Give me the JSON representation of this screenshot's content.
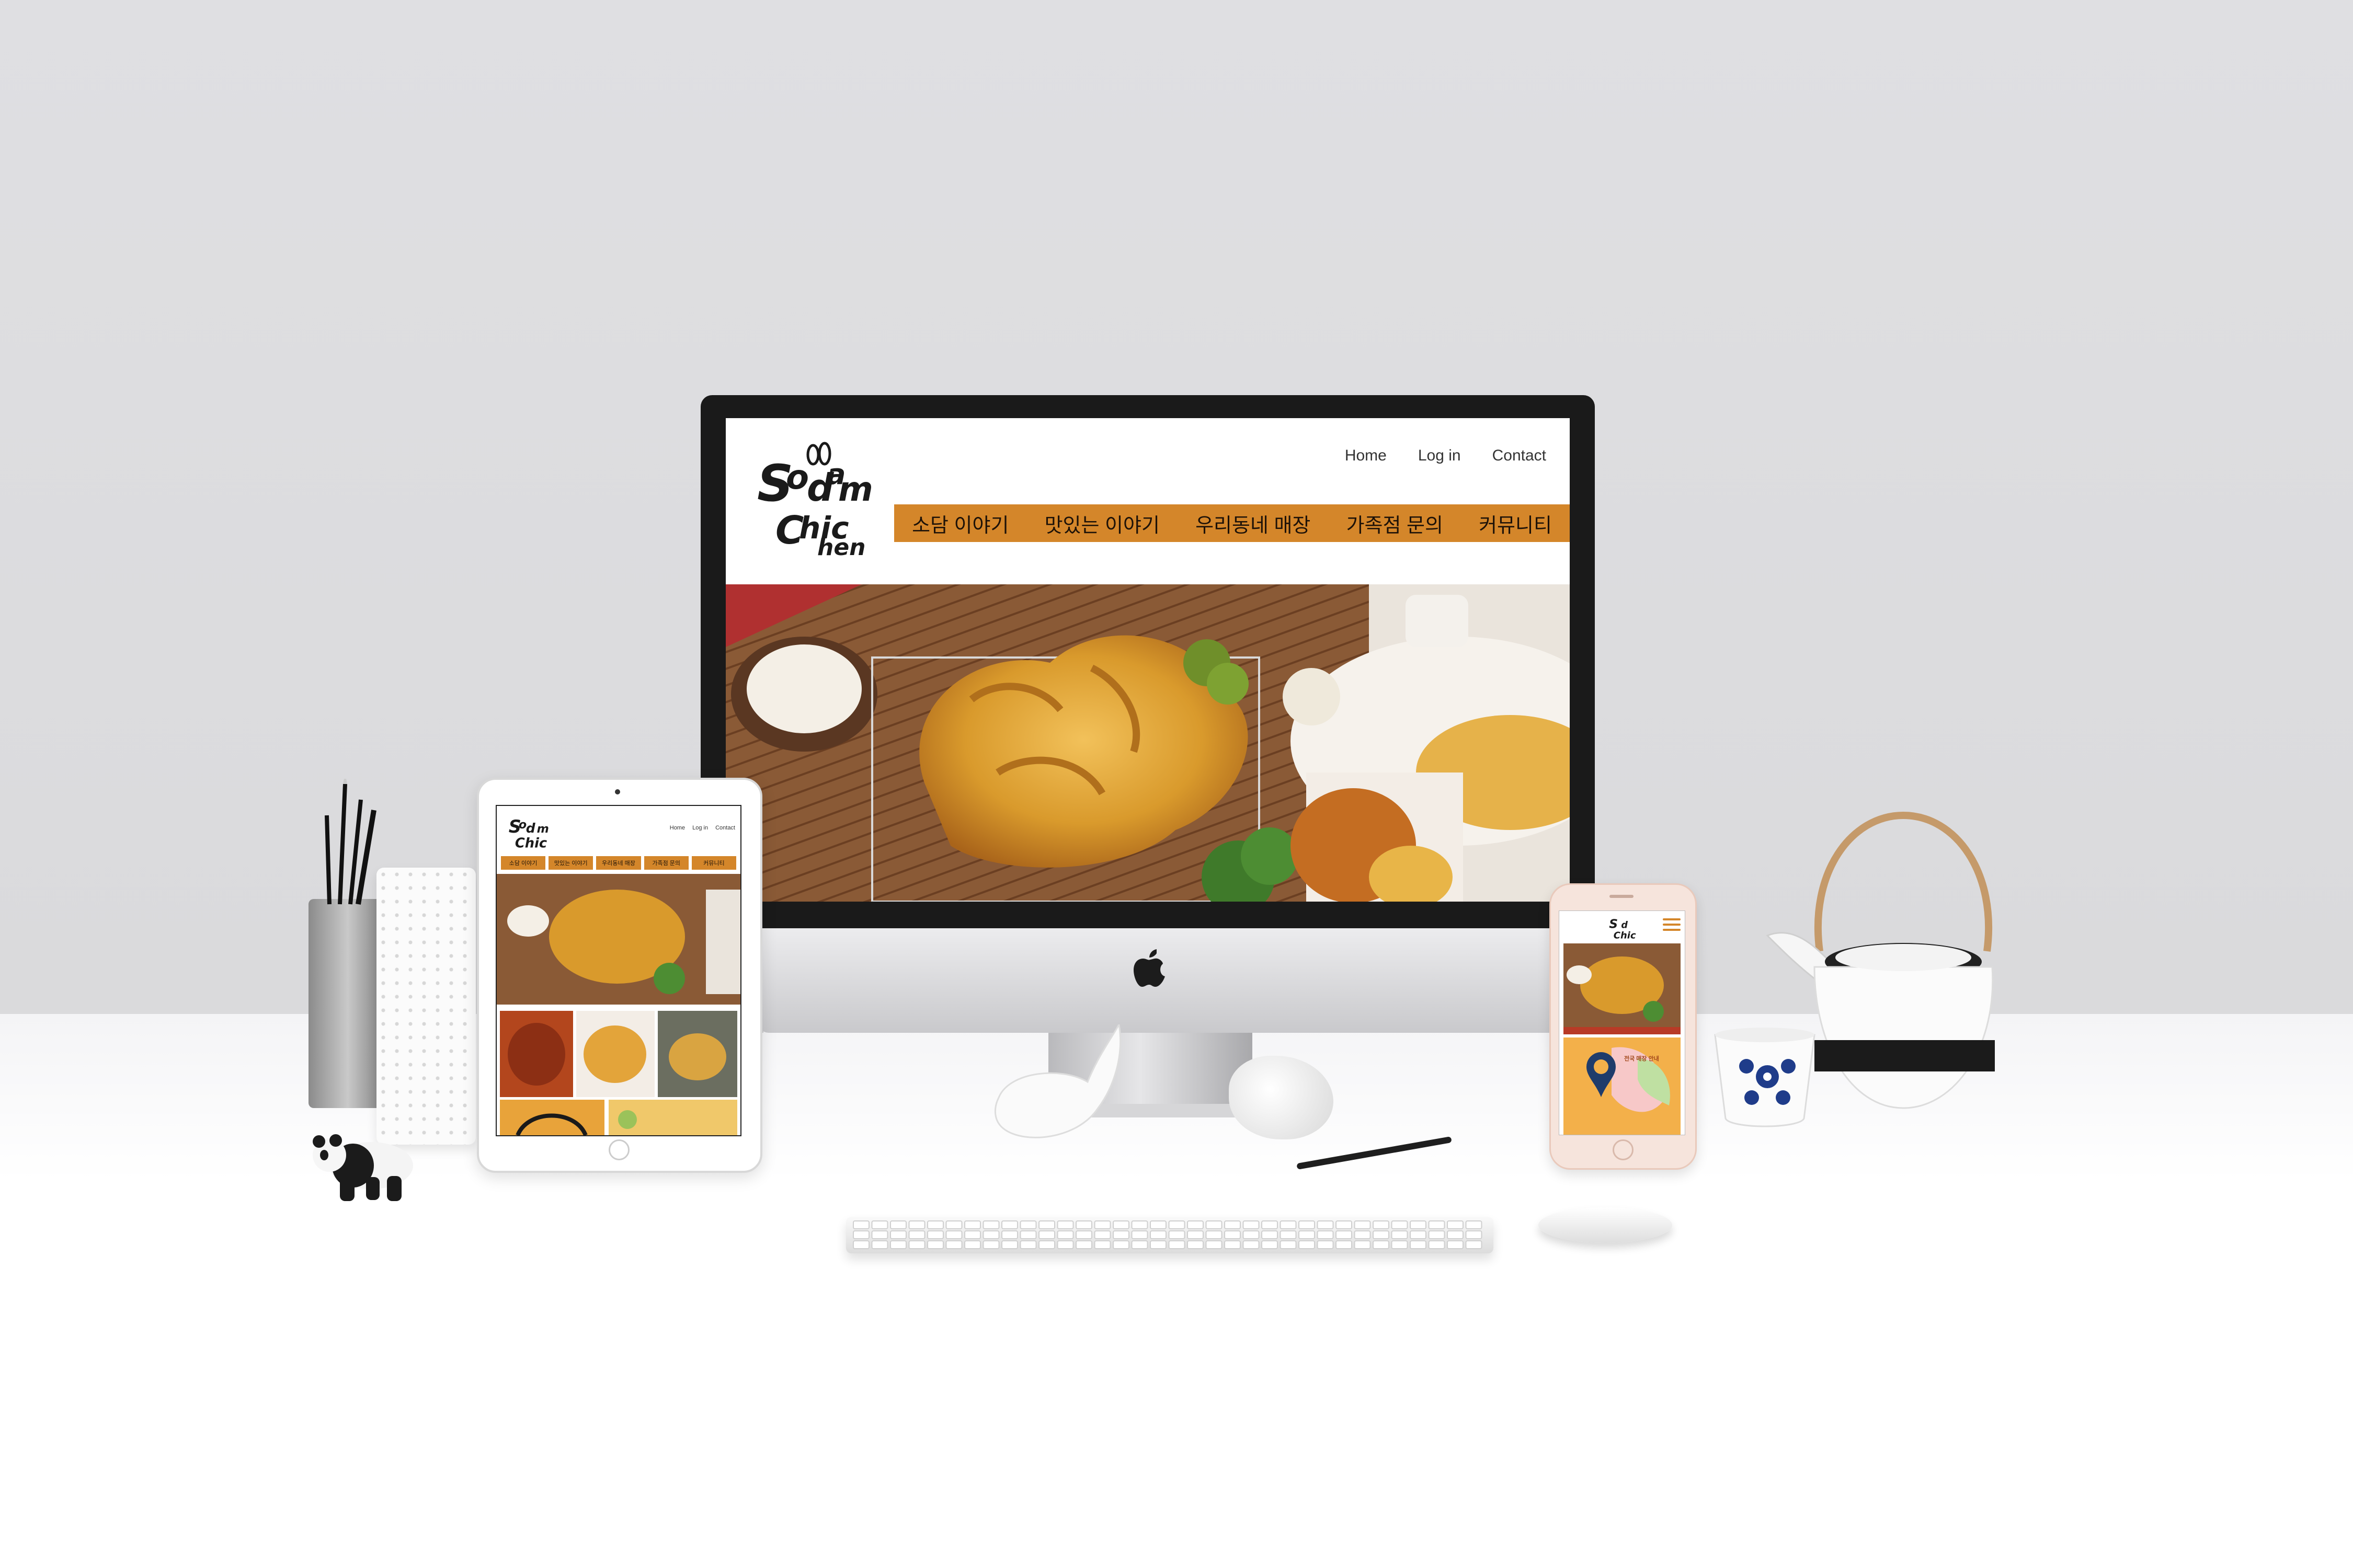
{
  "site": {
    "logo_text": "Sodam Chicken",
    "top_nav": [
      "Home",
      "Log in",
      "Contact"
    ],
    "main_nav": [
      "소담 이야기",
      "맛있는 이야기",
      "우리동네 매장",
      "가족점 문의",
      "커뮤니티"
    ]
  },
  "mobile": {
    "store_label": "전국 매장 안내"
  },
  "colors": {
    "nav_bar": "#d4862a",
    "wall": "#dcdcdf",
    "table": "#ffffff"
  },
  "icons": [
    "apple-logo-icon",
    "hamburger-menu-icon",
    "location-pin-icon"
  ]
}
